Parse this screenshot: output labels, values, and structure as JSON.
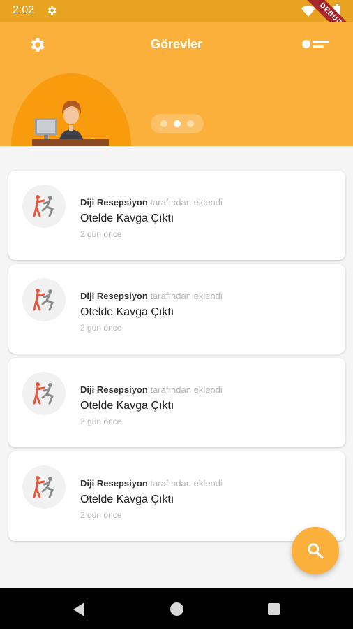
{
  "status_bar": {
    "time": "2:02",
    "debug_label": "DEBUG"
  },
  "header": {
    "title": "Görevler"
  },
  "pager": {
    "count": 3,
    "active_index": 1
  },
  "tasks": [
    {
      "author": "Diji Resepsiyon",
      "added_suffix": "tarafından eklendi",
      "title": "Otelde Kavga Çıktı",
      "time": "2 gün önce"
    },
    {
      "author": "Diji Resepsiyon",
      "added_suffix": "tarafından eklendi",
      "title": "Otelde Kavga Çıktı",
      "time": "2 gün önce"
    },
    {
      "author": "Diji Resepsiyon",
      "added_suffix": "tarafından eklendi",
      "title": "Otelde Kavga Çıktı",
      "time": "2 gün önce"
    },
    {
      "author": "Diji Resepsiyon",
      "added_suffix": "tarafından eklendi",
      "title": "Otelde Kavga Çıktı",
      "time": "2 gün önce"
    }
  ],
  "icons": {
    "status": [
      "gear-icon",
      "wifi-icon",
      "battery-icon"
    ],
    "header_left": "settings-gear-icon",
    "header_right": "toggle-icon",
    "task": "fight-icon",
    "fab": "search-icon"
  },
  "colors": {
    "accent": "#fbb03b",
    "status_bar": "#e8a420",
    "fight_red": "#e8533b",
    "fight_gray": "#8a8a8a",
    "debug": "#a6272d"
  }
}
